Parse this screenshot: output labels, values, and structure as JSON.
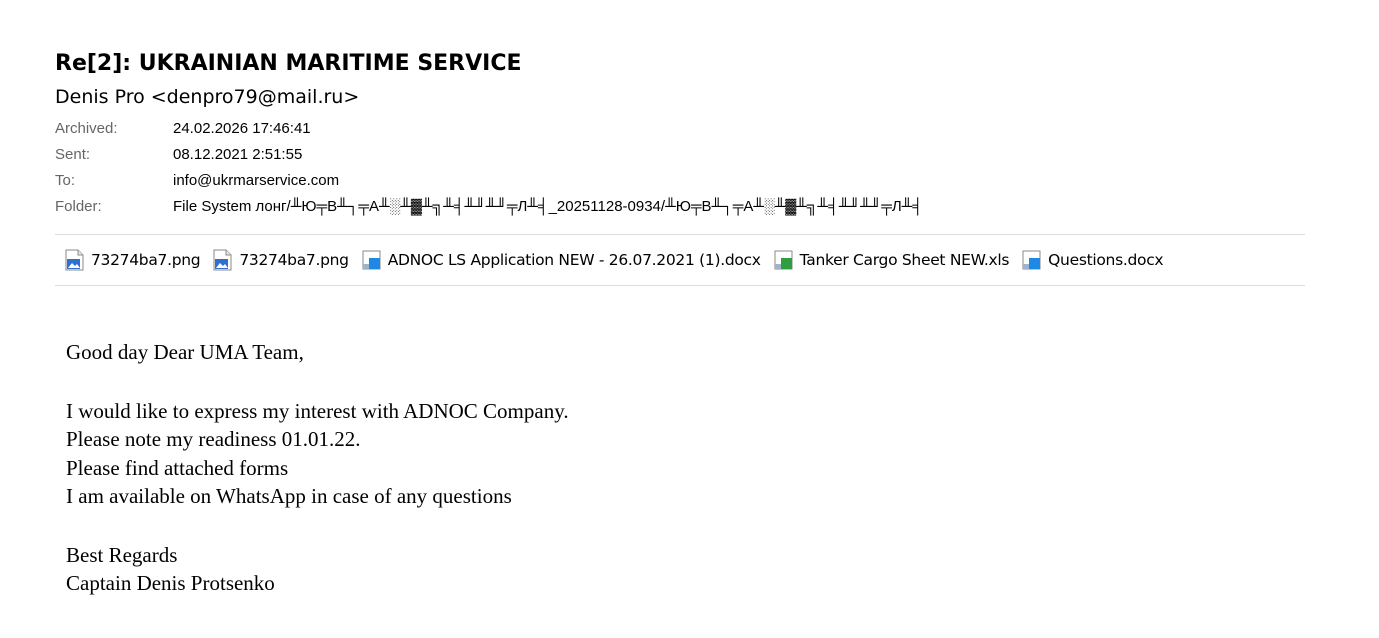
{
  "email": {
    "subject": "Re[2]: UKRAINIAN MARITIME SERVICE",
    "from": "Denis Pro <denpro79@mail.ru>",
    "meta": [
      {
        "label": "Archived:",
        "value": "24.02.2026 17:46:41"
      },
      {
        "label": "Sent:",
        "value": "08.12.2021 2:51:55"
      },
      {
        "label": "To:",
        "value": "info@ukrmarservice.com"
      },
      {
        "label": "Folder:",
        "value": "File System лонг/╨Ю╤В╨┐╤А╨░╨▓╨╗╨╡╨╜╨╜╤Л╨╡_20251128-0934/╨Ю╤В╨┐╤А╨░╨▓╨╗╨╡╨╜╨╜╤Л╨╡"
      }
    ],
    "attachments": [
      {
        "name": "73274ba7.png",
        "icon": "image-file-icon",
        "color": "#2f6fd1"
      },
      {
        "name": "73274ba7.png",
        "icon": "image-file-icon",
        "color": "#2f6fd1"
      },
      {
        "name": "ADNOC LS Application NEW - 26.07.2021 (1).docx",
        "icon": "word-document-icon",
        "color": "#1e88e5"
      },
      {
        "name": "Tanker Cargo Sheet NEW.xls",
        "icon": "excel-spreadsheet-icon",
        "color": "#2e9e3e"
      },
      {
        "name": "Questions.docx",
        "icon": "word-document-icon",
        "color": "#1e88e5"
      }
    ],
    "body": {
      "greeting": "Good day Dear UMA Team,",
      "lines": [
        "I would like to express my interest with ADNOC Company.",
        "Please note my readiness 01.01.22.",
        "Please find attached forms",
        "I am available on WhatsApp in case of any questions"
      ],
      "closing": "Best Regards",
      "signature": "Captain Denis Protsenko"
    }
  }
}
